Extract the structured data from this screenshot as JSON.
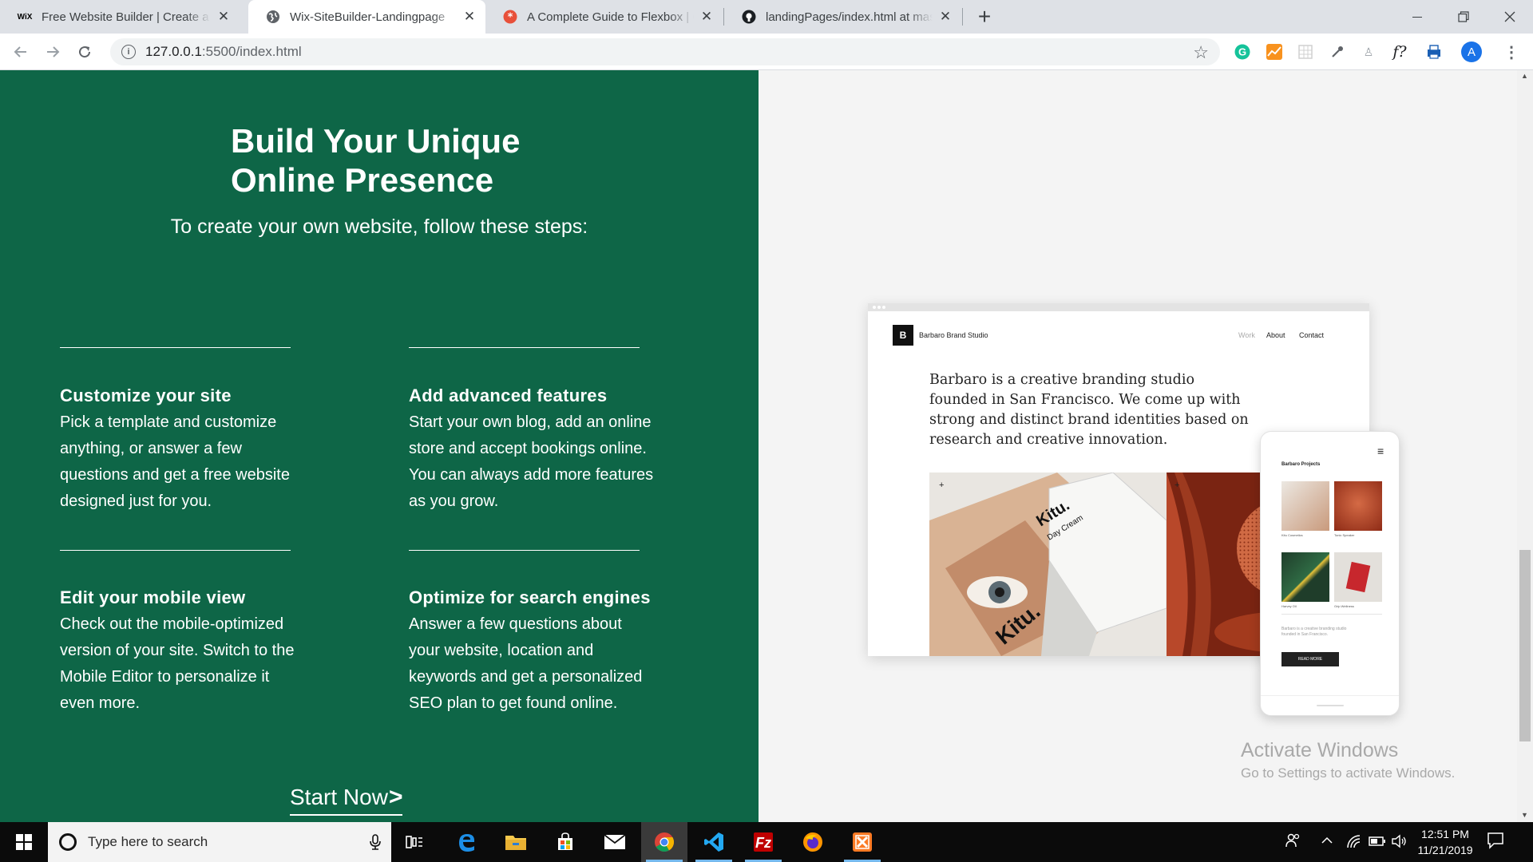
{
  "browser": {
    "tabs": [
      {
        "label": "Free Website Builder | Create a Fr",
        "favicon": "wix-icon",
        "active": false
      },
      {
        "label": "Wix-SiteBuilder-Landingpage",
        "favicon": "globe-icon",
        "active": true
      },
      {
        "label": "A Complete Guide to Flexbox | CS",
        "favicon": "css-tricks-icon",
        "active": false
      },
      {
        "label": "landingPages/index.html at mast",
        "favicon": "github-icon",
        "active": false
      }
    ],
    "favicon_text_wix": "WiX",
    "new_tab_symbol": "+",
    "url_host": "127.0.0.1",
    "url_path": ":5500/index.html",
    "profile_initial": "A",
    "ext_formula": "f?"
  },
  "page": {
    "headline_line1": "Build Your Unique",
    "headline_line2": "Online Presence",
    "subtitle": "To create your own website, follow these steps:",
    "steps": [
      {
        "title": "Customize your site",
        "text": "Pick a template and customize anything, or answer a few questions and get a free website designed just for you."
      },
      {
        "title": "Add advanced features",
        "text": "Start your own blog, add an online store and accept bookings online. You can always add more features as you grow."
      },
      {
        "title": "Edit your mobile view",
        "text": "Check out the mobile-optimized version of your site. Switch to the Mobile Editor to personalize it even more."
      },
      {
        "title": "Optimize for search engines",
        "text": "Answer a few questions about your website, location and keywords and get a personalized SEO plan to get found online."
      }
    ],
    "cta_label": "Start Now",
    "cta_arrow": ">",
    "colors": {
      "panel_green": "#0e6647",
      "right_bg": "#f4f4f4"
    }
  },
  "mockup": {
    "logo_letter": "B",
    "brand": "Barbaro Brand Studio",
    "nav": [
      "Work",
      "About",
      "Contact"
    ],
    "intro": "Barbaro is a creative branding studio founded in San Francisco. We come up with strong and distinct brand identities based on research and creative innovation.",
    "product_brand": "Kitu.",
    "product_name": "Day Cream",
    "phone": {
      "title": "Barbaro Projects",
      "captions": [
        "Kitu Cosmetics",
        "Tonic Speaker",
        "Harvey Oil",
        "Grip Wellness"
      ],
      "blurb": "Barbaro is a creative branding studio founded in San Francisco.",
      "button": "READ MORE"
    }
  },
  "watermark": {
    "line1": "Activate Windows",
    "line2": "Go to Settings to activate Windows."
  },
  "taskbar": {
    "search_placeholder": "Type here to search",
    "time": "12:51 PM",
    "date": "11/21/2019",
    "apps": [
      "task-view-icon",
      "edge-icon",
      "file-explorer-icon",
      "store-icon",
      "mail-icon",
      "chrome-icon",
      "vscode-icon",
      "filezilla-icon",
      "firefox-icon",
      "xampp-icon"
    ]
  }
}
